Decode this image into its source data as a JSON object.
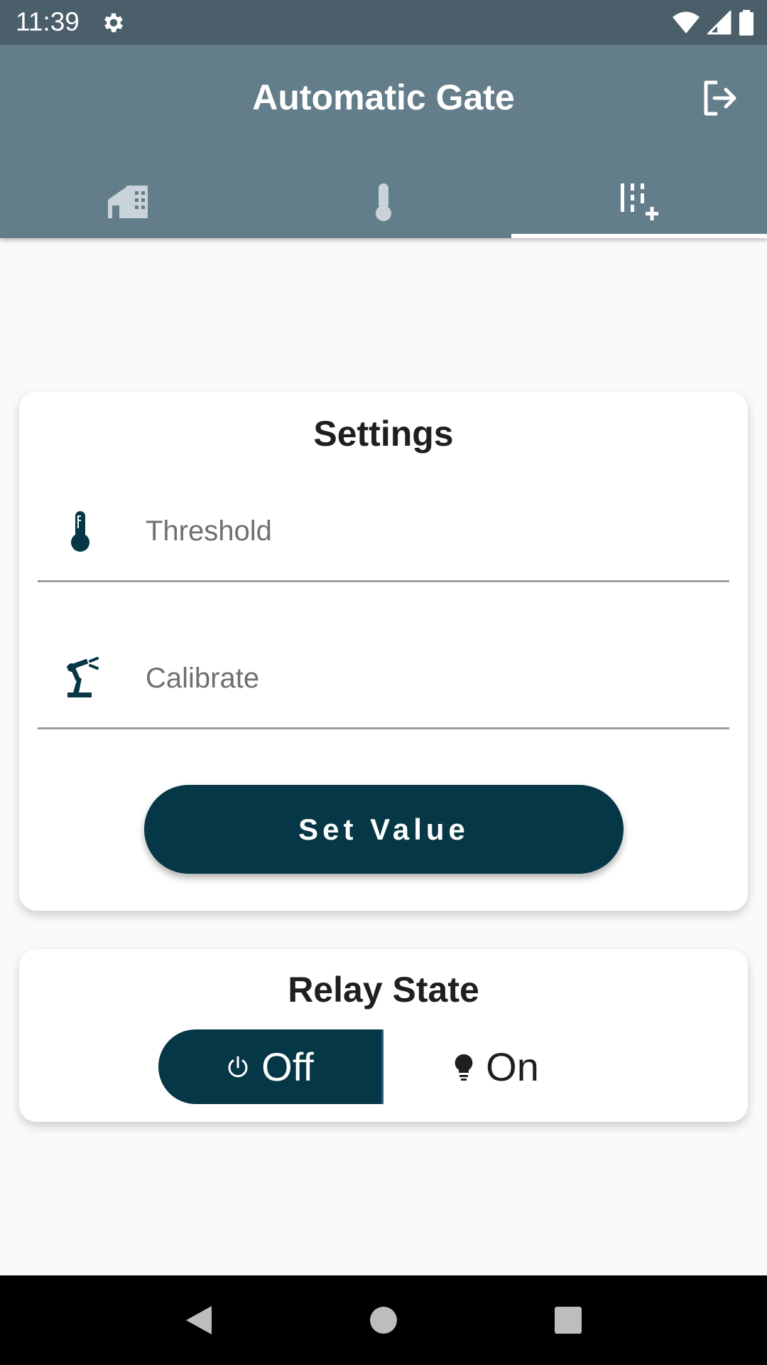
{
  "status_bar": {
    "time": "11:39",
    "icons": [
      "gear-icon",
      "wifi-icon",
      "signal-icon",
      "battery-icon"
    ]
  },
  "app_bar": {
    "title": "Automatic Gate",
    "action_icon": "logout-icon",
    "tabs": [
      {
        "icon": "home-icon",
        "selected": false
      },
      {
        "icon": "thermometer-icon",
        "selected": false
      },
      {
        "icon": "settings-sliders-icon",
        "selected": true
      }
    ]
  },
  "settings": {
    "title": "Settings",
    "threshold": {
      "icon": "thermometer-icon",
      "placeholder": "Threshold",
      "value": ""
    },
    "calibrate": {
      "icon": "robot-arm-icon",
      "placeholder": "Calibrate",
      "value": ""
    },
    "button_label": "Set Value"
  },
  "relay": {
    "title": "Relay State",
    "options": [
      {
        "label": "Off",
        "icon": "power-icon",
        "selected": true
      },
      {
        "label": "On",
        "icon": "lightbulb-icon",
        "selected": false
      }
    ]
  },
  "colors": {
    "status_bar": "#4b5f6a",
    "app_bar": "#637d8a",
    "accent": "#063746",
    "background": "#fafafa"
  },
  "nav_bar": {
    "buttons": [
      "back-icon",
      "home-circle-icon",
      "recents-icon"
    ]
  }
}
